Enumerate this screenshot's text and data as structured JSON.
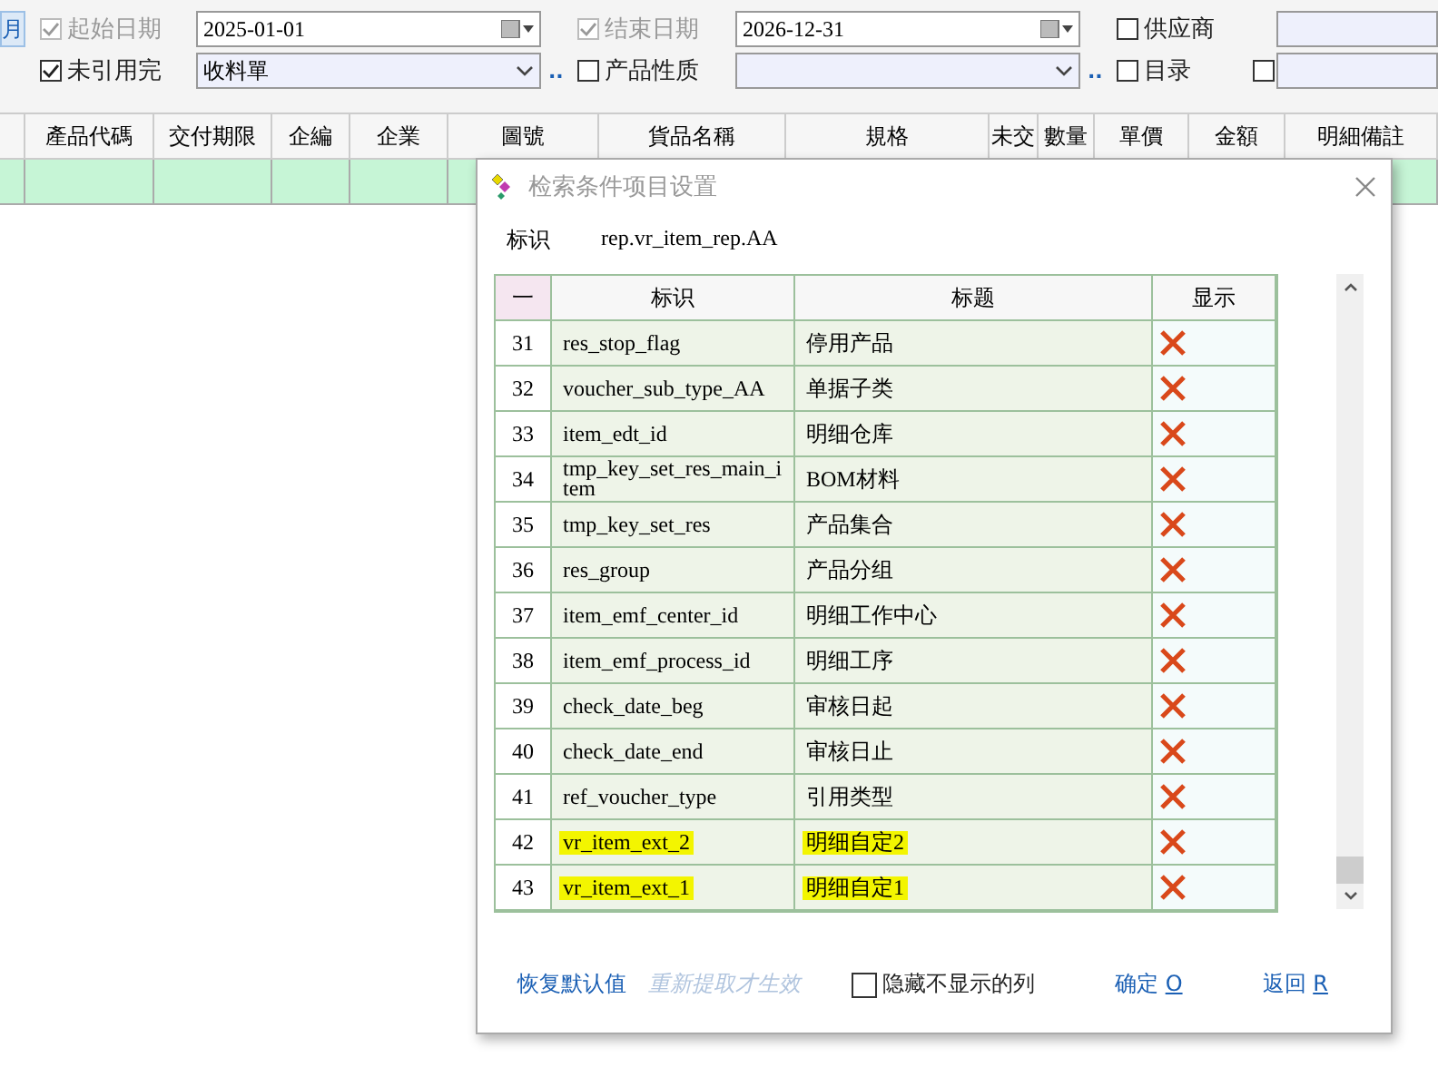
{
  "filters": {
    "side_button": "月",
    "row1": [
      {
        "kind": "check",
        "label": "起始日期",
        "checked": true,
        "disabled": true
      },
      {
        "kind": "date",
        "value": "2025-01-01"
      },
      {
        "kind": "check",
        "label": "结束日期",
        "checked": true,
        "disabled": true
      },
      {
        "kind": "date",
        "value": "2026-12-31"
      },
      {
        "kind": "check",
        "label": "供应商",
        "checked": false,
        "disabled": false
      },
      {
        "kind": "field"
      }
    ],
    "row2": [
      {
        "kind": "check",
        "label": "未引用完",
        "checked": true,
        "disabled": false
      },
      {
        "kind": "combo",
        "value": "收料單"
      },
      {
        "kind": "dots",
        "label": ".."
      },
      {
        "kind": "check",
        "label": "产品性质",
        "checked": false,
        "disabled": false
      },
      {
        "kind": "combo"
      },
      {
        "kind": "dots",
        "label": ".."
      },
      {
        "kind": "check",
        "label": "目录",
        "checked": false,
        "disabled": false
      },
      {
        "kind": "check",
        "checked": false,
        "disabled": false
      },
      {
        "kind": "field"
      }
    ]
  },
  "table": {
    "columns": [
      "產品代碼",
      "交付期限",
      "企編",
      "企業",
      "圖號",
      "貨品名稱",
      "規格",
      "未交",
      "數量",
      "單價",
      "金額",
      "明細備註"
    ]
  },
  "dialog": {
    "title": "检索条件项目设置",
    "id_label": "标识",
    "id_value": "rep.vr_item_rep.AA",
    "columns": [
      "一",
      "标识",
      "标题",
      "显示"
    ],
    "rows": [
      {
        "no": "31",
        "id": "res_stop_flag",
        "title": "停用产品",
        "shown": false,
        "highlighted": false
      },
      {
        "no": "32",
        "id": "voucher_sub_type_AA",
        "title": "单据子类",
        "shown": false,
        "highlighted": false
      },
      {
        "no": "33",
        "id": "item_edt_id",
        "title": "明细仓库",
        "shown": false,
        "highlighted": false
      },
      {
        "no": "34",
        "id": "tmp_key_set_res_main_item",
        "title": "BOM材料",
        "shown": false,
        "highlighted": false
      },
      {
        "no": "35",
        "id": "tmp_key_set_res",
        "title": "产品集合",
        "shown": false,
        "highlighted": false
      },
      {
        "no": "36",
        "id": "res_group",
        "title": "产品分组",
        "shown": false,
        "highlighted": false
      },
      {
        "no": "37",
        "id": "item_emf_center_id",
        "title": "明细工作中心",
        "shown": false,
        "highlighted": false
      },
      {
        "no": "38",
        "id": "item_emf_process_id",
        "title": "明细工序",
        "shown": false,
        "highlighted": false
      },
      {
        "no": "39",
        "id": "check_date_beg",
        "title": "审核日起",
        "shown": false,
        "highlighted": false
      },
      {
        "no": "40",
        "id": "check_date_end",
        "title": "审核日止",
        "shown": false,
        "highlighted": false
      },
      {
        "no": "41",
        "id": "ref_voucher_type",
        "title": "引用类型",
        "shown": false,
        "highlighted": false
      },
      {
        "no": "42",
        "id": "vr_item_ext_2",
        "title": "明细自定2",
        "shown": false,
        "highlighted": true
      },
      {
        "no": "43",
        "id": "vr_item_ext_1",
        "title": "明细自定1",
        "shown": false,
        "highlighted": true
      }
    ],
    "reset": "恢复默认值",
    "hint": "重新提取才生效",
    "hide_option": {
      "label": "隐藏不显示的列",
      "checked": false
    },
    "ok": {
      "label": "确定",
      "key": "O"
    },
    "back": {
      "label": "返回",
      "key": "R"
    }
  }
}
